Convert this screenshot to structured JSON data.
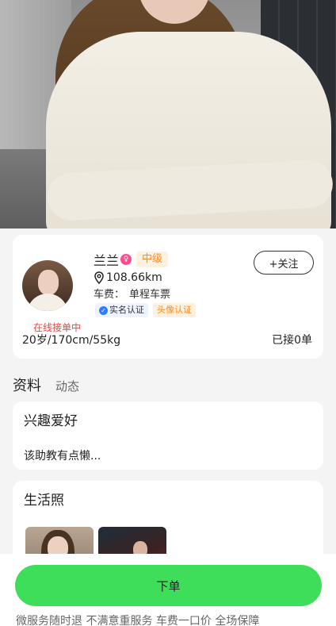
{
  "profile": {
    "name": "兰兰",
    "level": "中级",
    "distance": "108.66km",
    "fee_label": "车费：",
    "fee_value": "单程车票",
    "verified_badge": "实名认证",
    "avatar_badge": "头像认证",
    "online_status": "在线接单中",
    "follow_label": "+关注",
    "stats": "20岁/170cm/55kg",
    "orders": "已接0单"
  },
  "tabs": {
    "active": "资料",
    "other": "动态"
  },
  "hobbies": {
    "title": "兴趣爱好",
    "text": "该助教有点懒..."
  },
  "photos": {
    "title": "生活照"
  },
  "bottom": {
    "order_label": "下单",
    "guarantee": "微服务随时退 不满意重服务 车费一口价 全场保障"
  },
  "colors": {
    "accent_green": "#3ede5b",
    "level_orange": "#ff8a1f",
    "online_red": "#ff3b30",
    "gender_pink": "#ff4d8d",
    "verified_blue": "#2f7bff"
  },
  "icons": {
    "gender": "female-icon",
    "location": "location-pin-icon",
    "verified": "check-badge-icon"
  }
}
